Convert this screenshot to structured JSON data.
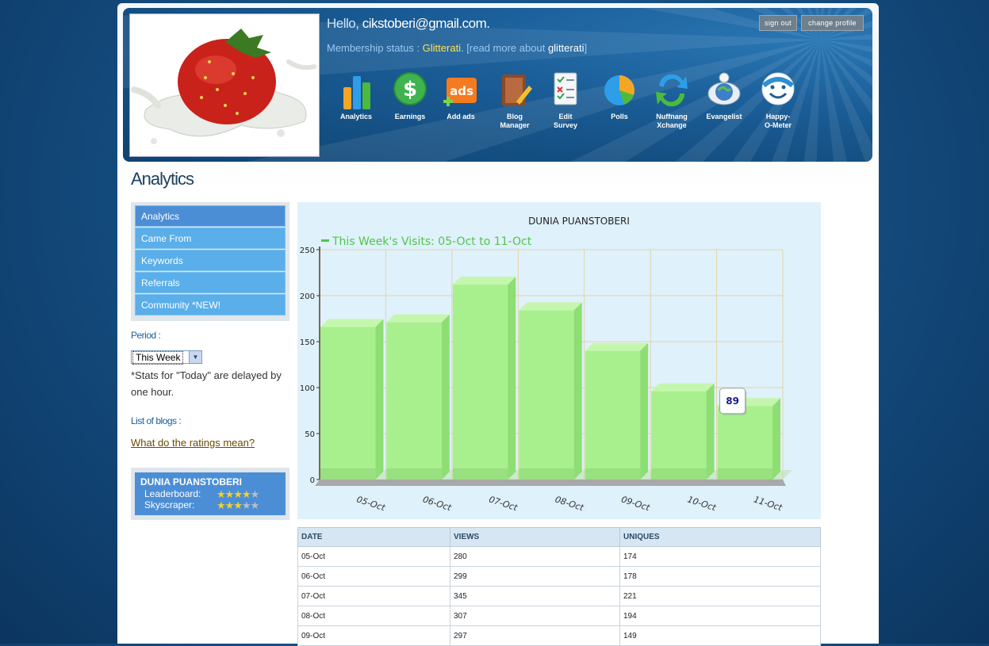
{
  "header": {
    "hello_label": "Hello,",
    "email": "cikstoberi@gmail.com.",
    "membership_label": "Membership status :",
    "membership_status": "Glitterati",
    "read_more_prefix": ". [read more about",
    "read_more_link": "glitterati",
    "read_more_suffix": "]",
    "sign_out": "sign out",
    "change_profile": "change profile"
  },
  "toolbar": [
    {
      "label1": "Analytics",
      "label2": ""
    },
    {
      "label1": "Earnings",
      "label2": ""
    },
    {
      "label1": "Add ads",
      "label2": ""
    },
    {
      "label1": "Blog",
      "label2": "Manager"
    },
    {
      "label1": "Edit",
      "label2": "Survey"
    },
    {
      "label1": "Polls",
      "label2": ""
    },
    {
      "label1": "Nuffnang",
      "label2": "Xchange"
    },
    {
      "label1": "Evangelist",
      "label2": ""
    },
    {
      "label1": "Happy-",
      "label2": "O-Meter"
    }
  ],
  "icon_names": [
    "analytics-icon",
    "earnings-icon",
    "add-ads-icon",
    "blog-manager-icon",
    "edit-survey-icon",
    "polls-icon",
    "nuffnang-xchange-icon",
    "evangelist-icon",
    "happy-o-meter-icon"
  ],
  "page_title": "Analytics",
  "sidebar": {
    "items": [
      {
        "label": "Analytics",
        "active": true
      },
      {
        "label": "Came From",
        "active": false
      },
      {
        "label": "Keywords",
        "active": false
      },
      {
        "label": "Referrals",
        "active": false
      },
      {
        "label": "Community *NEW!",
        "active": false
      }
    ],
    "period_label": "Period :",
    "period_value": "This Week",
    "stats_note": "*Stats for \"Today\" are delayed by one hour.",
    "list_label": "List of blogs :",
    "ratings_link": "What do the ratings mean?",
    "blog": {
      "name": "DUNIA PUANSTOBERI",
      "leaderboard_label": "Leaderboard:",
      "leaderboard_stars": 4,
      "skyscraper_label": "Skyscraper:",
      "skyscraper_stars": 3,
      "max_stars": 5
    }
  },
  "colors": {
    "bar": "#a8f08e",
    "bar_side": "#8ede73",
    "bar_top": "#c4f7ad",
    "legend": "#4fc64a",
    "nav": "#5aaee9",
    "nav_active": "#4c8ed6"
  },
  "chart_data": {
    "type": "bar",
    "title": "DUNIA PUANSTOBERI",
    "legend": "This Week's Visits: 05-Oct to 11-Oct",
    "categories": [
      "05-Oct",
      "06-Oct",
      "07-Oct",
      "08-Oct",
      "09-Oct",
      "10-Oct",
      "11-Oct"
    ],
    "values": [
      166,
      171,
      212,
      184,
      140,
      96,
      80
    ],
    "ylim": [
      0,
      250
    ],
    "yticks": [
      0,
      50,
      100,
      150,
      200,
      250
    ],
    "tooltip": {
      "category": "11-Oct",
      "text": "89"
    },
    "grid": true
  },
  "table": {
    "headers": [
      "DATE",
      "VIEWS",
      "UNIQUES"
    ],
    "rows": [
      [
        "05-Oct",
        "280",
        "174"
      ],
      [
        "06-Oct",
        "299",
        "178"
      ],
      [
        "07-Oct",
        "345",
        "221"
      ],
      [
        "08-Oct",
        "307",
        "194"
      ],
      [
        "09-Oct",
        "297",
        "149"
      ]
    ]
  }
}
